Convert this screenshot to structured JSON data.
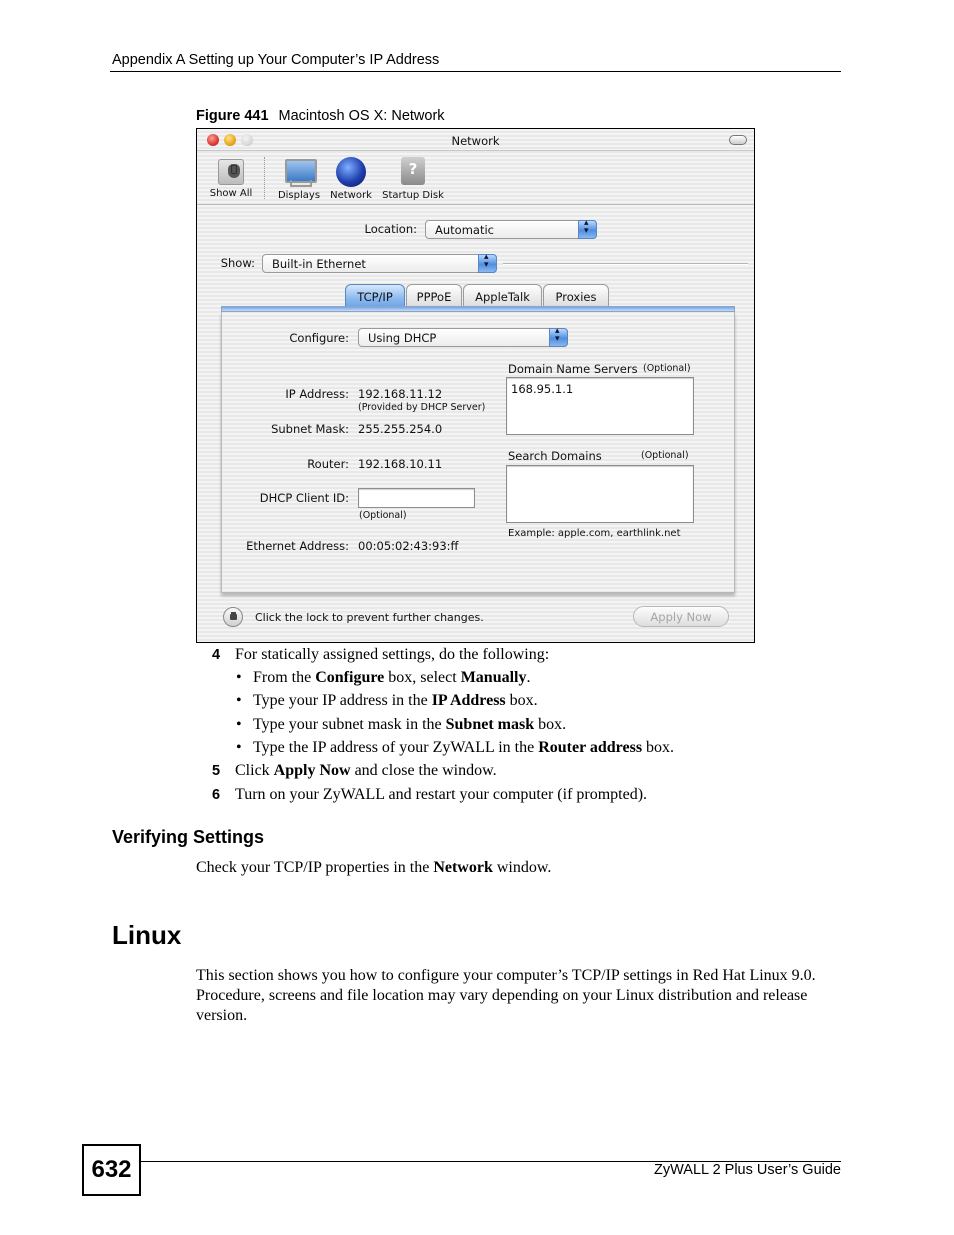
{
  "page": {
    "running_header": "Appendix A Setting up Your Computer’s IP Address",
    "figure": {
      "label": "Figure 441",
      "title": "Macintosh OS X: Network"
    },
    "footer": {
      "page_number": "632",
      "guide_title": "ZyWALL 2 Plus User’s Guide"
    }
  },
  "window": {
    "title": "Network",
    "toolbar": [
      {
        "label": "Show All",
        "icon": "show-all-icon"
      },
      {
        "label": "Displays",
        "icon": "display-icon"
      },
      {
        "label": "Network",
        "icon": "globe-icon"
      },
      {
        "label": "Startup Disk",
        "icon": "hard-disk-icon"
      }
    ],
    "location": {
      "label": "Location:",
      "value": "Automatic"
    },
    "show": {
      "label": "Show:",
      "value": "Built-in Ethernet"
    },
    "tabs": [
      {
        "label": "TCP/IP",
        "active": true
      },
      {
        "label": "PPPoE",
        "active": false
      },
      {
        "label": "AppleTalk",
        "active": false
      },
      {
        "label": "Proxies",
        "active": false
      }
    ],
    "tcpip": {
      "configure": {
        "label": "Configure:",
        "value": "Using DHCP"
      },
      "ip_address": {
        "label": "IP Address:",
        "value": "192.168.11.12",
        "note": "(Provided by DHCP Server)"
      },
      "subnet_mask": {
        "label": "Subnet Mask:",
        "value": "255.255.254.0"
      },
      "router": {
        "label": "Router:",
        "value": "192.168.10.11"
      },
      "dhcp_client_id": {
        "label": "DHCP Client ID:",
        "value": "",
        "note": "(Optional)"
      },
      "ethernet_address": {
        "label": "Ethernet Address:",
        "value": "00:05:02:43:93:ff"
      },
      "dns": {
        "label": "Domain Name Servers",
        "optional": "(Optional)",
        "value": "168.95.1.1"
      },
      "search_domains": {
        "label": "Search Domains",
        "optional": "(Optional)",
        "value": "",
        "example": "Example: apple.com, earthlink.net"
      }
    },
    "lock_text": "Click the lock to prevent further changes.",
    "apply_button": "Apply Now"
  },
  "steps": [
    {
      "num": "4",
      "text": "For statically assigned settings, do the following:",
      "bullets": [
        {
          "pre": "From the ",
          "b1": "Configure",
          "mid": " box, select ",
          "b2": "Manually",
          "post": "."
        },
        {
          "pre": "Type your IP address in the ",
          "b1": "IP Address",
          "post": " box."
        },
        {
          "pre": "Type your subnet mask in the ",
          "b1": "Subnet mask",
          "post": " box."
        },
        {
          "pre": "Type the IP address of your ZyWALL in the ",
          "b1": "Router address",
          "post": " box."
        }
      ]
    },
    {
      "num": "5",
      "pre": "Click ",
      "bold": "Apply Now",
      "post": " and close the window."
    },
    {
      "num": "6",
      "text": "Turn on your ZyWALL and restart your computer (if prompted)."
    }
  ],
  "verifying": {
    "heading": "Verifying Settings",
    "pre": "Check your TCP/IP properties in the ",
    "bold": "Network",
    "post": " window."
  },
  "linux": {
    "heading": "Linux",
    "paragraph": "This section shows you how to configure your computer’s TCP/IP settings in Red Hat Linux 9.0. Procedure, screens and file location may vary depending on your Linux distribution and release version."
  }
}
